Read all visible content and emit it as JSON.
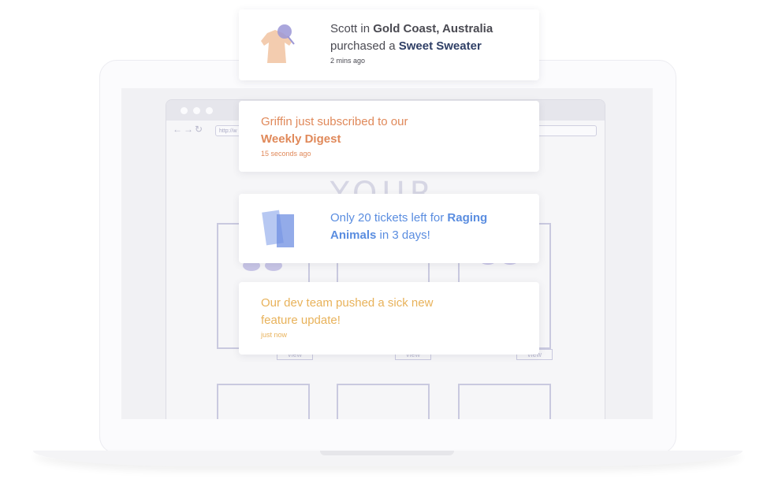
{
  "mockup": {
    "address": "http://w",
    "site_title": "YOUR WEBSITE",
    "view_label": "view"
  },
  "notifications": [
    {
      "icon": "sweater-icon",
      "name": "Scott",
      "in_text": " in ",
      "location": "Gold Coast, Australia",
      "action": "purchased a ",
      "product": "Sweet Sweater",
      "time": "2 mins ago",
      "colors": {
        "text": "#4a4a52",
        "product": "#2f3f66"
      }
    },
    {
      "line1": "Griffin just subscribed to our",
      "line2": "Weekly Digest",
      "time": "15 seconds ago",
      "color": "#e0895a"
    },
    {
      "icon": "tickets-icon",
      "pre": "Only 20 tickets left for ",
      "event_a": "Raging",
      "event_b": "Animals",
      "post": " in 3 days!",
      "color": "#5a8de0"
    },
    {
      "line1": "Our dev team pushed a sick new",
      "line2": "feature update!",
      "time": "just now",
      "color": "#e8b25a"
    }
  ]
}
